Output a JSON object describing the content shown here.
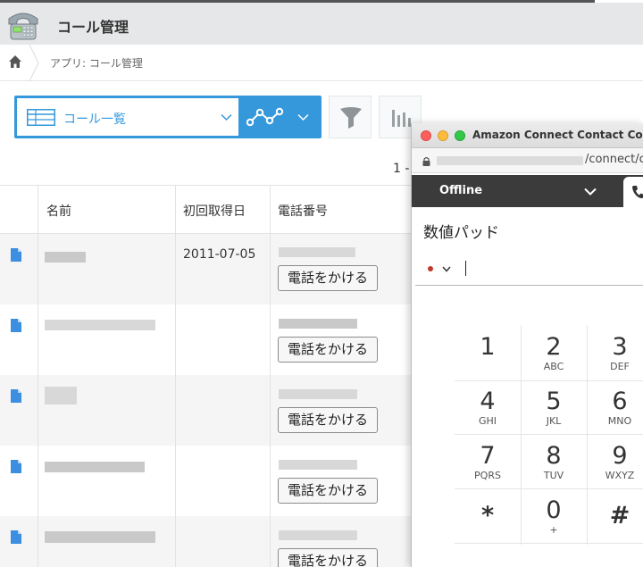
{
  "app": {
    "title": "コール管理",
    "breadcrumb": "アプリ: コール管理"
  },
  "toolbar": {
    "view_name": "コール一覧",
    "pager": "1 -"
  },
  "table": {
    "headers": [
      "名前",
      "初回取得日",
      "電話番号"
    ],
    "rows": [
      {
        "date": "2011-07-05",
        "call_label": "電話をかける"
      },
      {
        "date": "",
        "call_label": "電話をかける"
      },
      {
        "date": "",
        "call_label": "電話をかける"
      },
      {
        "date": "",
        "call_label": "電話をかける"
      },
      {
        "date": "",
        "call_label": "電話をかける"
      }
    ]
  },
  "ccp": {
    "window_title": "Amazon Connect Contact Cont",
    "url_suffix": "/connect/c",
    "status": "Offline",
    "pad_title": "数値パッド",
    "keys": [
      {
        "digit": "1",
        "letters": ""
      },
      {
        "digit": "2",
        "letters": "ABC"
      },
      {
        "digit": "3",
        "letters": "DEF"
      },
      {
        "digit": "4",
        "letters": "GHI"
      },
      {
        "digit": "5",
        "letters": "JKL"
      },
      {
        "digit": "6",
        "letters": "MNO"
      },
      {
        "digit": "7",
        "letters": "PQRS"
      },
      {
        "digit": "8",
        "letters": "TUV"
      },
      {
        "digit": "9",
        "letters": "WXYZ"
      },
      {
        "digit": "*",
        "letters": ""
      },
      {
        "digit": "0",
        "letters": "+"
      },
      {
        "digit": "#",
        "letters": ""
      }
    ]
  },
  "colors": {
    "accent": "#3498db",
    "status_bar": "#3b3b3b",
    "status_dot": "#c0392b"
  },
  "icons": [
    "telephone-logo-icon",
    "home-icon",
    "table-icon",
    "chevron-down-icon",
    "graph-icon",
    "filter-icon",
    "bar-chart-icon",
    "document-icon",
    "lock-icon",
    "phone-icon"
  ]
}
